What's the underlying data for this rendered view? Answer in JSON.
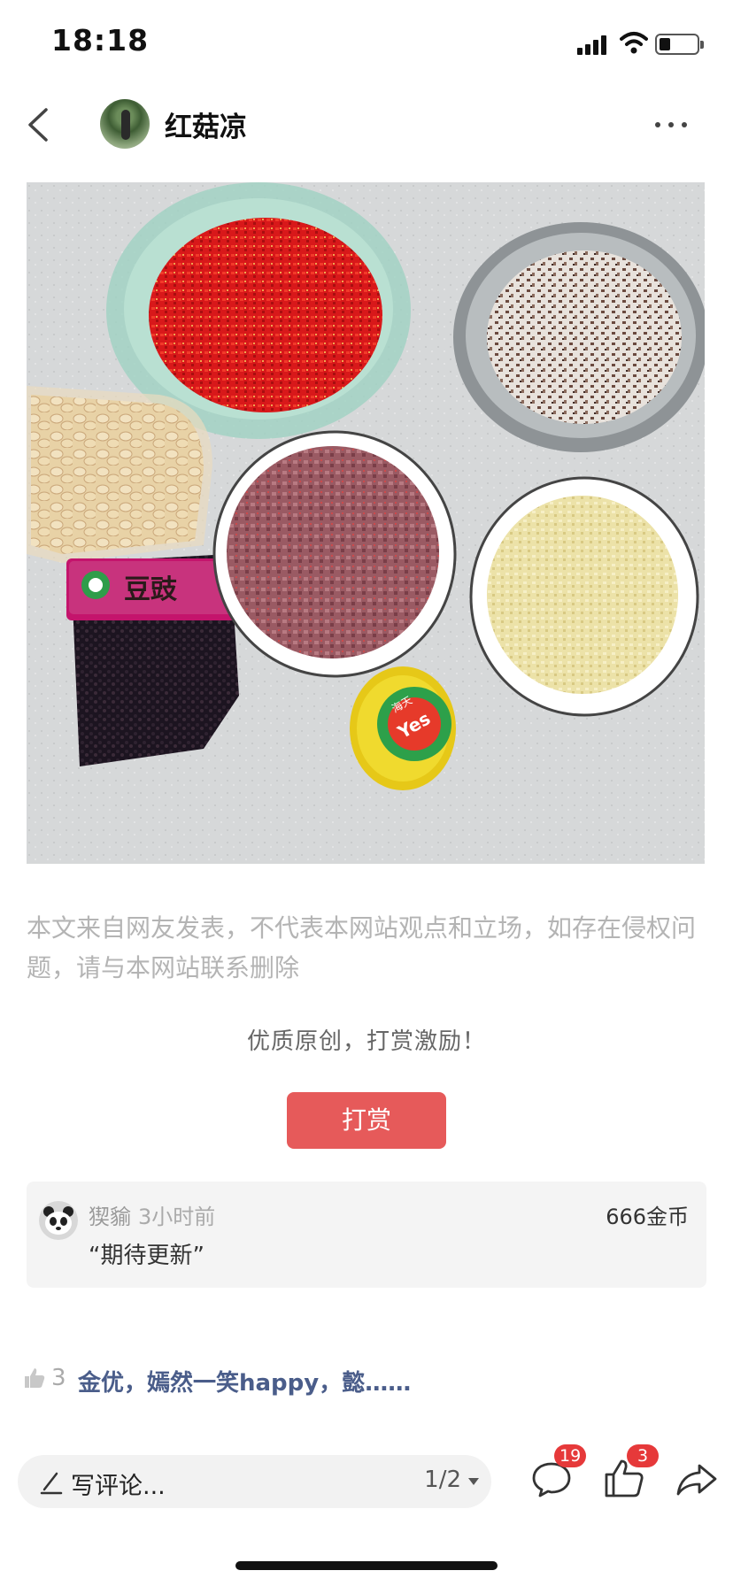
{
  "status_bar": {
    "time": "18:18",
    "icons": [
      "signal-icon",
      "wifi-icon",
      "battery-icon"
    ]
  },
  "header": {
    "back_icon": "chevron-left-icon",
    "author_name": "红菇凉",
    "more_icon": "more-dots-icon"
  },
  "photo": {
    "package_label": "豆豉",
    "jar_label": "Yes",
    "jar_brand": "海天"
  },
  "disclaimer": "本文来自网友发表，不代表本网站观点和立场，如存在侵权问题，请与本网站联系删除",
  "reward": {
    "prompt": "优质原创，打赏激励！",
    "button_label": "打赏"
  },
  "tip": {
    "user": "猰貐",
    "time": "3小时前",
    "amount": "666金币",
    "message": "“期待更新”"
  },
  "likes": {
    "count": "3",
    "names": "金优，嫣然一笑happy，懿……"
  },
  "bottom_bar": {
    "comment_placeholder": "写评论...",
    "page_indicator": "1/2",
    "comment_count": "19",
    "like_count": "3",
    "icons": [
      "pen-icon",
      "comment-icon",
      "thumbs-up-icon",
      "share-icon"
    ]
  },
  "colors": {
    "accent_red": "#e65a5a",
    "badge_red": "#e6393a",
    "link_blue": "#4a5d8a"
  }
}
